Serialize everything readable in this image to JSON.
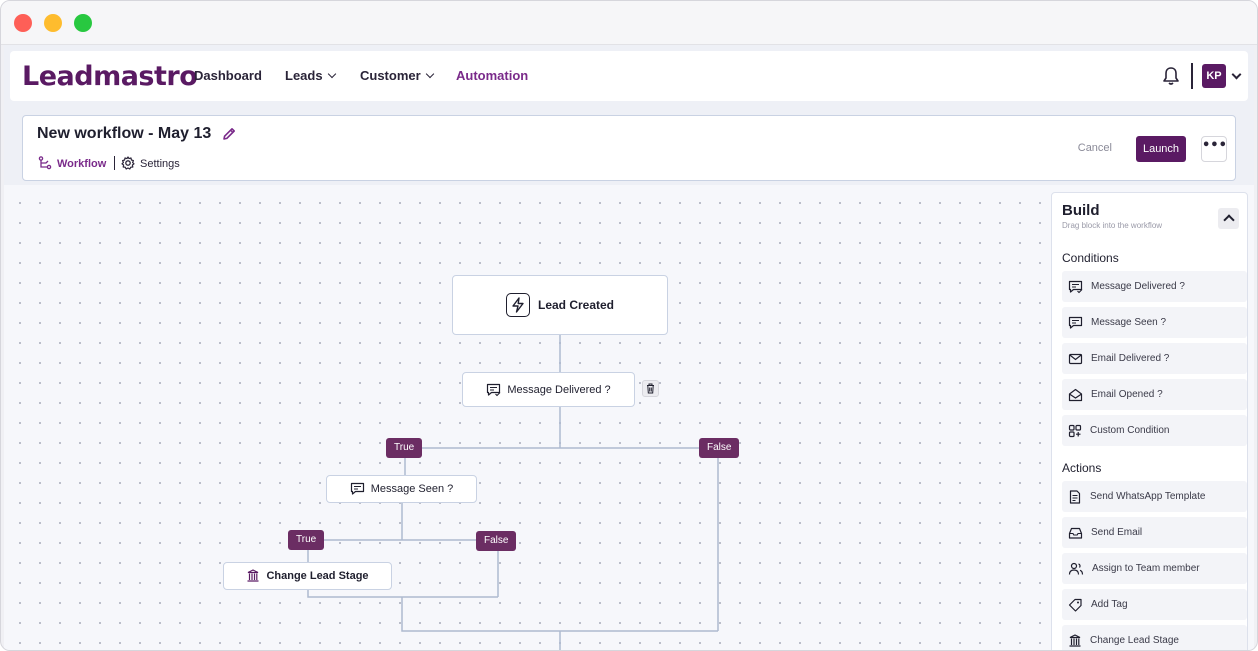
{
  "navbar": {
    "logo": "Leadmastro",
    "items": [
      {
        "label": "Dashboard"
      },
      {
        "label": "Leads"
      },
      {
        "label": "Customer"
      },
      {
        "label": "Automation"
      }
    ],
    "avatar_initials": "KP"
  },
  "workflow": {
    "title": "New workflow - May 13",
    "tabs": [
      {
        "label": "Workflow"
      },
      {
        "label": "Settings"
      }
    ],
    "cancel_label": "Cancel",
    "launch_label": "Launch",
    "more_label": "•••"
  },
  "canvas": {
    "trigger": "Lead Created",
    "nodes": [
      {
        "label": "Message Delivered ?"
      },
      {
        "label": "Message Seen ?"
      },
      {
        "label": "Change Lead Stage"
      }
    ],
    "branches": [
      {
        "label": "True"
      },
      {
        "label": "False"
      },
      {
        "label": "True"
      },
      {
        "label": "False"
      }
    ]
  },
  "build": {
    "title": "Build",
    "subtitle": "Drag block into the workflow",
    "conditions_heading": "Conditions",
    "conditions": [
      {
        "label": "Message Delivered ?",
        "icon": "message-delivered-icon"
      },
      {
        "label": "Message Seen ?",
        "icon": "message-seen-icon"
      },
      {
        "label": "Email Delivered ?",
        "icon": "email-delivered-icon"
      },
      {
        "label": "Email Opened ?",
        "icon": "email-opened-icon"
      },
      {
        "label": "Custom Condition",
        "icon": "custom-condition-icon"
      }
    ],
    "actions_heading": "Actions",
    "actions": [
      {
        "label": "Send WhatsApp Template",
        "icon": "document-icon"
      },
      {
        "label": "Send Email",
        "icon": "inbox-icon"
      },
      {
        "label": "Assign to Team member",
        "icon": "users-icon"
      },
      {
        "label": "Add Tag",
        "icon": "tag-icon"
      },
      {
        "label": "Change Lead Stage",
        "icon": "building-icon"
      }
    ]
  },
  "colors": {
    "brand": "#5a1a63",
    "accent": "#7a2a8a",
    "branch_pill": "#6b2d63"
  }
}
